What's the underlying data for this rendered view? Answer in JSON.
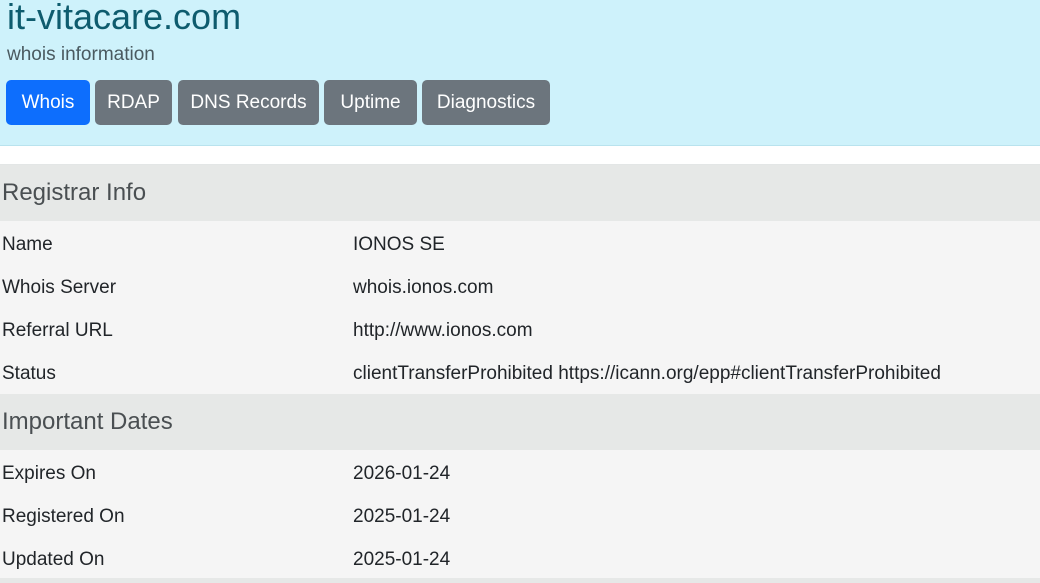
{
  "header": {
    "title": "it-vitacare.com",
    "subtitle": "whois information",
    "tabs": [
      {
        "label": "Whois",
        "active": true
      },
      {
        "label": "RDAP",
        "active": false
      },
      {
        "label": "DNS Records",
        "active": false
      },
      {
        "label": "Uptime",
        "active": false
      },
      {
        "label": "Diagnostics",
        "active": false
      }
    ]
  },
  "registrar": {
    "heading": "Registrar Info",
    "rows": [
      {
        "key": "Name",
        "value": "IONOS SE"
      },
      {
        "key": "Whois Server",
        "value": "whois.ionos.com"
      },
      {
        "key": "Referral URL",
        "value": "http://www.ionos.com"
      },
      {
        "key": "Status",
        "value": "clientTransferProhibited https://icann.org/epp#clientTransferProhibited"
      }
    ]
  },
  "dates": {
    "heading": "Important Dates",
    "rows": [
      {
        "key": "Expires On",
        "value": "2026-01-24"
      },
      {
        "key": "Registered On",
        "value": "2025-01-24"
      },
      {
        "key": "Updated On",
        "value": "2025-01-24"
      }
    ]
  },
  "colors": {
    "header_bg": "#cef2fb",
    "title": "#0e5c6e",
    "tab_active": "#0d6efd",
    "tab_inactive": "#6c757d",
    "section_bg": "#e6e8e7",
    "row_bg": "#f5f5f5"
  }
}
